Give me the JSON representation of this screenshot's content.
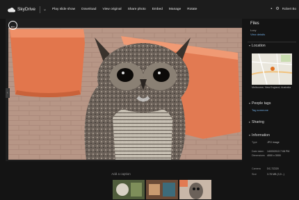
{
  "app": {
    "title": "SkyDrive"
  },
  "commands": [
    "Play slide show",
    "Download",
    "View original",
    "Share photo",
    "Embed",
    "Manage",
    "Rotate"
  ],
  "user": {
    "name": "Robert Bo"
  },
  "viewer": {
    "caption_prompt": "Add a caption"
  },
  "panel": {
    "title": "Files",
    "title_sub": "Lucy",
    "view_details_link": "View details",
    "location_header": "Location",
    "map_caption": "Melbourne, New England, Australia",
    "people_header": "People tags",
    "people_link": "Tag someone",
    "sharing_header": "Sharing",
    "info_header": "Information",
    "info": [
      {
        "label": "Type",
        "value": "JPG image"
      },
      {
        "label": "Date taken",
        "value": "14/03/2013 7:08 PM"
      },
      {
        "label": "Dimensions",
        "value": "4000 x 3000"
      },
      {
        "label": "Camera",
        "value": "DC-TZ220"
      },
      {
        "label": "Size",
        "value": "3.78 MB (3,9...)"
      }
    ]
  },
  "colors": {
    "topbar": "#1c1c1c",
    "accent_link": "#6fa8dc",
    "map_pin": "#e07020"
  }
}
